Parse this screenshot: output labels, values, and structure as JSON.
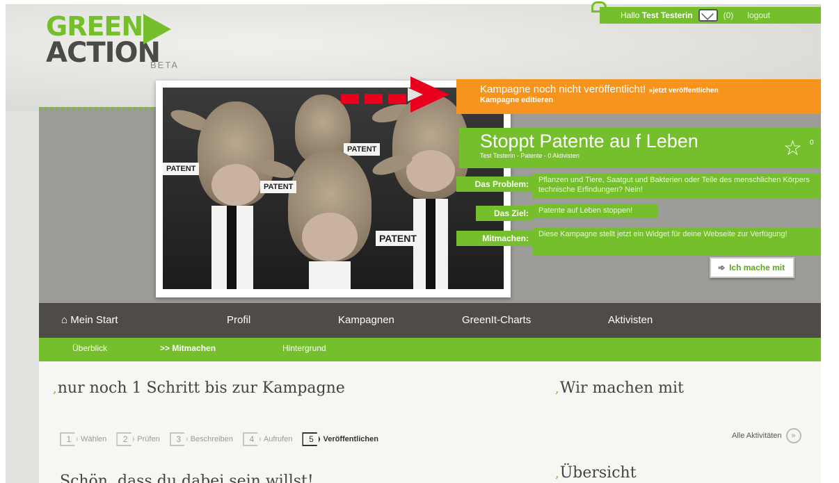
{
  "user_bar": {
    "greeting": "Hallo",
    "username": "Test Testerin",
    "mail_count": "(0)",
    "logout": "logout"
  },
  "logo": {
    "line1": "GREEN",
    "line2": "ACTION",
    "badge": "BETA"
  },
  "notice": {
    "text": "Kampagne noch nicht veröffentlicht!",
    "publish_link": "»jetzt veröffentlichen",
    "edit_link": "Kampagne editieren"
  },
  "campaign": {
    "title": "Stoppt Patente au f Leben",
    "meta": "Test Testerin - Patente - 0 Aktivisten",
    "star_count": "0",
    "problem_label": "Das Problem:",
    "problem_text": "Pflanzen und Tiere, Saatgut und Bakterien oder Teile des menschlichen Körpers technische Erfindungen? Nein!",
    "goal_label": "Das Ziel:",
    "goal_text": "Patente auf Leben stoppen!",
    "join_label": "Mitmachen:",
    "join_text": "Diese Kampagne stellt jetzt ein Widget für deine Webseite zur Verfügung!",
    "cta": "Ich mache mit"
  },
  "photo": {
    "tags": [
      "PATENT",
      "PATENT",
      "PATENT",
      "PATENT"
    ]
  },
  "main_nav": {
    "items": [
      "Mein Start",
      "Profil",
      "Kampagnen",
      "GreenIt-Charts",
      "Aktivisten"
    ]
  },
  "sub_nav": {
    "items": [
      "Überblick",
      ">> Mitmachen",
      "Hintergrund"
    ]
  },
  "content": {
    "heading_left": "nur noch 1 Schritt bis zur Kampagne",
    "heading_right": "Wir machen mit",
    "heading_overview": "Übersicht",
    "heading_bottom": "Schön, dass du dabei sein willst!",
    "alle": "Alle Aktivitäten",
    "steps": [
      {
        "num": "1",
        "label": "Wählen"
      },
      {
        "num": "2",
        "label": "Prüfen"
      },
      {
        "num": "3",
        "label": "Beschreiben"
      },
      {
        "num": "4",
        "label": "Aufrufen"
      },
      {
        "num": "5",
        "label": "Veröffentlichen"
      }
    ]
  },
  "colors": {
    "brand_green": "#74bf2b",
    "notice_orange": "#f7941d",
    "arrow_red": "#e8001c",
    "nav_dark": "#4e4b48"
  }
}
